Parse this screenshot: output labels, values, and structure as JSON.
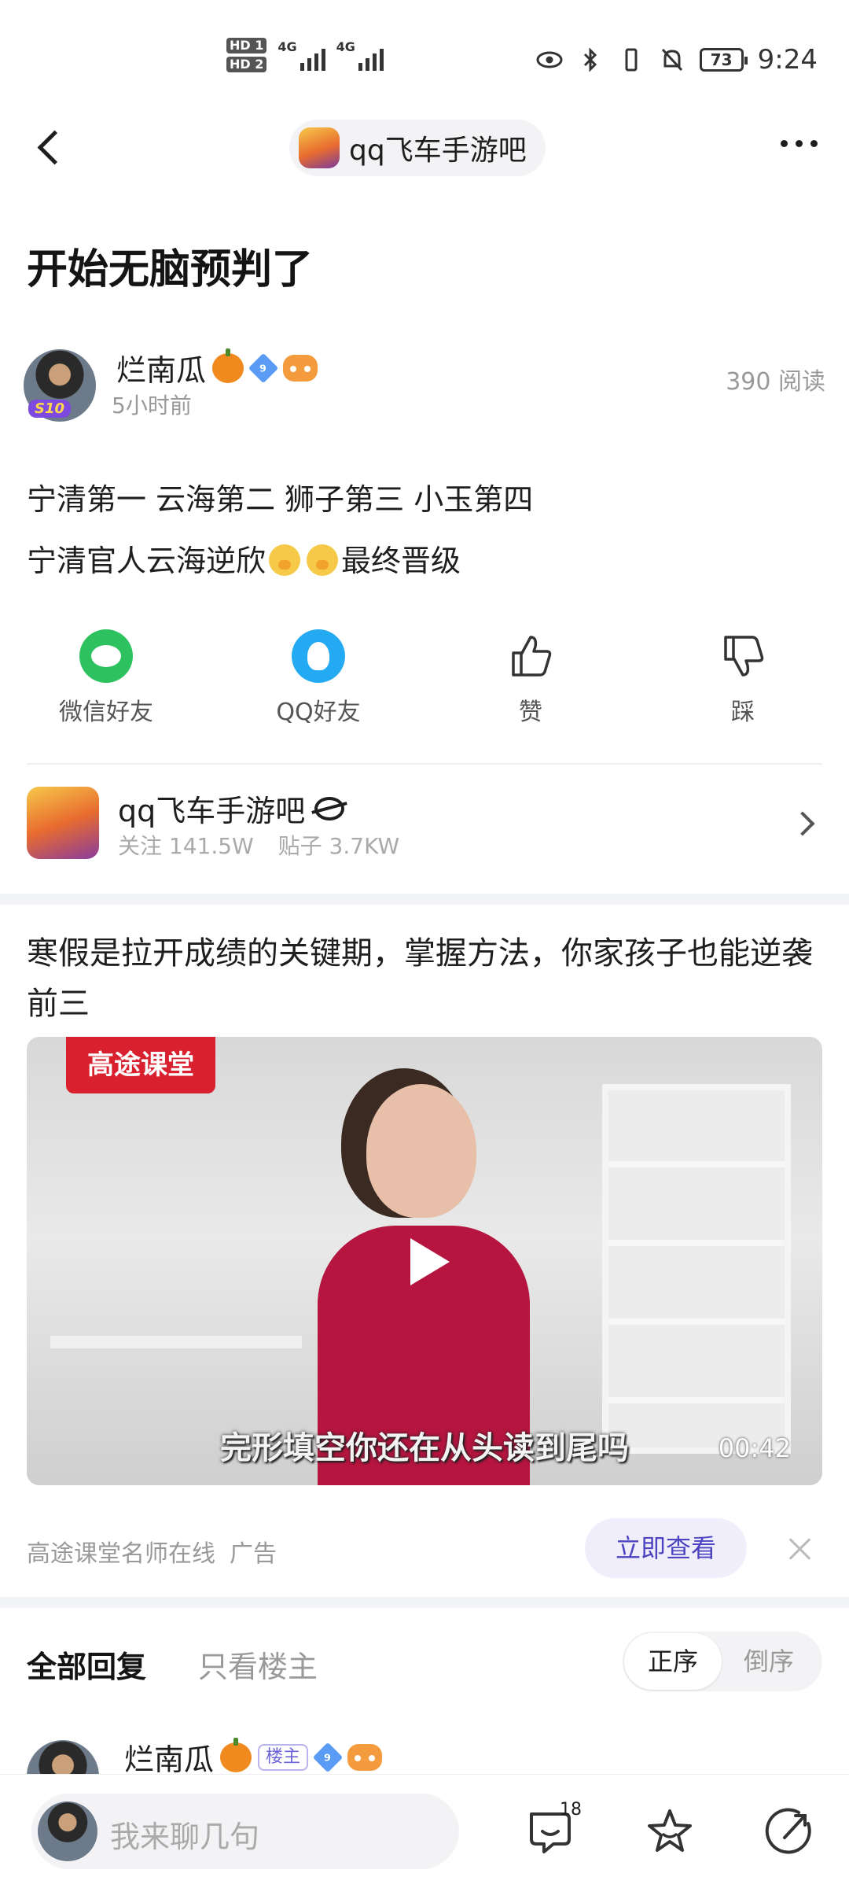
{
  "status": {
    "hd1": "HD 1",
    "hd2": "HD 2",
    "net1": "4G",
    "net2": "4G",
    "battery": "73",
    "time": "9:24"
  },
  "header": {
    "forum_name": "qq飞车手游吧"
  },
  "post": {
    "title": "开始无脑预判了",
    "author": "烂南瓜",
    "avatar_badge": "S10",
    "level": "9",
    "time_ago": "5小时前",
    "reads": "390 阅读",
    "line1": "宁清第一 云海第二 狮子第三 小玉第四",
    "line2_pre": "宁清官人云海逆欣",
    "line2_post": "最终晋级"
  },
  "share": {
    "wechat": "微信好友",
    "qq": "QQ好友",
    "like": "赞",
    "dislike": "踩"
  },
  "forum_card": {
    "name": "qq飞车手游吧",
    "followers": "关注 141.5W",
    "posts": "贴子 3.7KW"
  },
  "ad": {
    "title": "寒假是拉开成绩的关键期，掌握方法，你家孩子也能逆袭前三",
    "brand_tag": "高途课堂",
    "subtitle": "完形填空你还在从头读到尾吗",
    "duration": "00:42",
    "source": "高途课堂名师在线",
    "ad_label": "广告",
    "cta": "立即查看"
  },
  "replies": {
    "tab_all": "全部回复",
    "tab_host": "只看楼主",
    "sort_asc": "正序",
    "sort_desc": "倒序",
    "first_author": "烂南瓜",
    "host_tag": "楼主",
    "first_level": "9"
  },
  "bottom": {
    "placeholder": "我来聊几句",
    "comment_count": "18"
  },
  "colors": {
    "accent": "#4c44c0",
    "wechat": "#2ec15f",
    "qq": "#24aaf3",
    "ad_red": "#d9202e"
  }
}
